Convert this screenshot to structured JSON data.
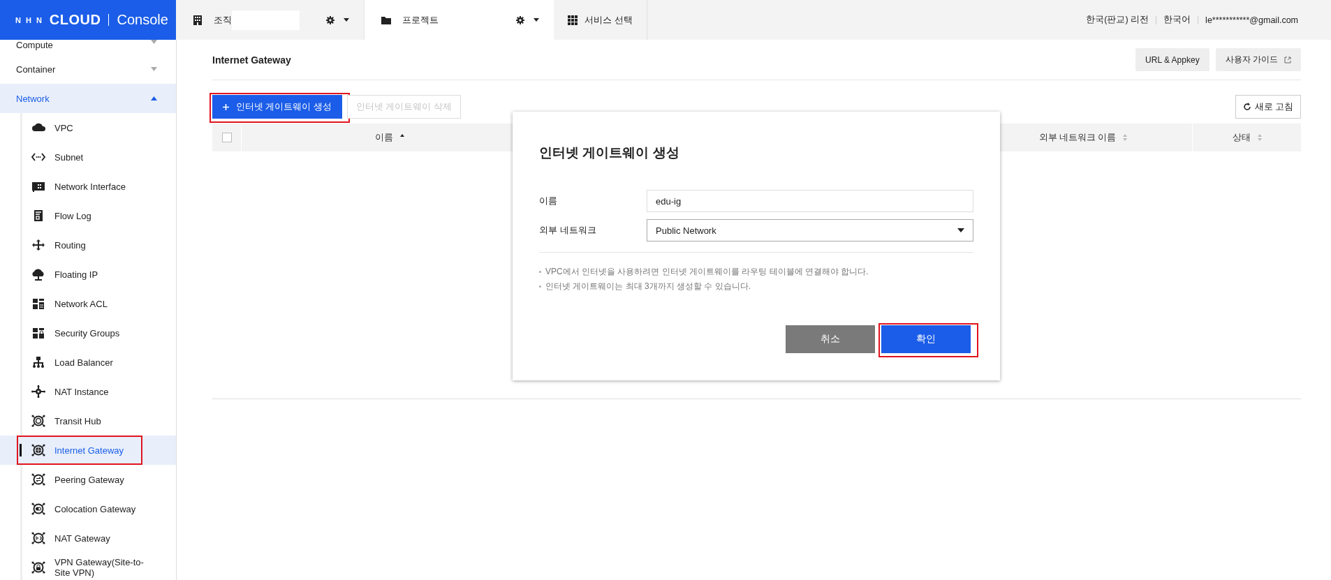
{
  "logo": {
    "brand": "NHN",
    "product": "CLOUD",
    "app": "Console"
  },
  "topbar": {
    "org": {
      "label": "조직",
      "redacted": true
    },
    "project": {
      "label": "프로젝트"
    },
    "service": {
      "label": "서비스 선택"
    },
    "right": [
      "한국(판교) 리전",
      "한국어",
      "le***********@gmail.com"
    ]
  },
  "sidebar": {
    "categories": [
      {
        "label": "Compute",
        "expanded": false,
        "selected": false
      },
      {
        "label": "Container",
        "expanded": false,
        "selected": false
      },
      {
        "label": "Network",
        "expanded": true,
        "selected": true,
        "children": [
          {
            "label": "VPC",
            "selected": false,
            "annotated": false
          },
          {
            "label": "Subnet",
            "selected": false,
            "annotated": false
          },
          {
            "label": "Network Interface",
            "selected": false,
            "annotated": false
          },
          {
            "label": "Flow Log",
            "selected": false,
            "annotated": false
          },
          {
            "label": "Routing",
            "selected": false,
            "annotated": false
          },
          {
            "label": "Floating IP",
            "selected": false,
            "annotated": false
          },
          {
            "label": "Network ACL",
            "selected": false,
            "annotated": false
          },
          {
            "label": "Security Groups",
            "selected": false,
            "annotated": false
          },
          {
            "label": "Load Balancer",
            "selected": false,
            "annotated": false
          },
          {
            "label": "NAT Instance",
            "selected": false,
            "annotated": false
          },
          {
            "label": "Transit Hub",
            "selected": false,
            "annotated": false
          },
          {
            "label": "Internet Gateway",
            "selected": true,
            "annotated": true
          },
          {
            "label": "Peering Gateway",
            "selected": false,
            "annotated": false
          },
          {
            "label": "Colocation Gateway",
            "selected": false,
            "annotated": false
          },
          {
            "label": "NAT Gateway",
            "selected": false,
            "annotated": false
          },
          {
            "label": "VPN Gateway(Site-to-Site VPN)",
            "selected": false,
            "annotated": false
          }
        ]
      }
    ]
  },
  "page": {
    "title": "Internet Gateway",
    "header_buttons": [
      "URL & Appkey",
      "사용자 가이드"
    ],
    "toolbar": [
      {
        "label": "인터넷 게이트웨이 생성",
        "kind": "primary",
        "disabled": false,
        "annotated": true
      },
      {
        "label": "인터넷 게이트웨이 삭제",
        "kind": "plain",
        "disabled": true,
        "annotated": false
      }
    ],
    "refresh": "새로 고침",
    "table": {
      "select_all_checked": false,
      "columns": [
        {
          "label": "이름",
          "sorted_ascending": true
        },
        {
          "label": "외부 네트워크 이름",
          "sorted_ascending": false
        },
        {
          "label": "상태",
          "sorted_ascending": false
        }
      ]
    }
  },
  "dialog": {
    "title": "인터넷 게이트웨이 생성",
    "fields": [
      {
        "label": "이름",
        "kind": "text",
        "value": "edu-ig"
      },
      {
        "label": "외부 네트워크",
        "kind": "select",
        "value": "Public Network"
      }
    ],
    "notes": [
      "VPC에서 인터넷을 사용하려면 인터넷 게이트웨이를 라우팅 테이블에 연결해야 합니다.",
      "인터넷 게이트웨이는 최대 3개까지 생성할 수 있습니다."
    ],
    "buttons": [
      {
        "label": "취소",
        "kind": "cancel",
        "annotated": false
      },
      {
        "label": "확인",
        "kind": "confirm",
        "annotated": true
      }
    ]
  }
}
